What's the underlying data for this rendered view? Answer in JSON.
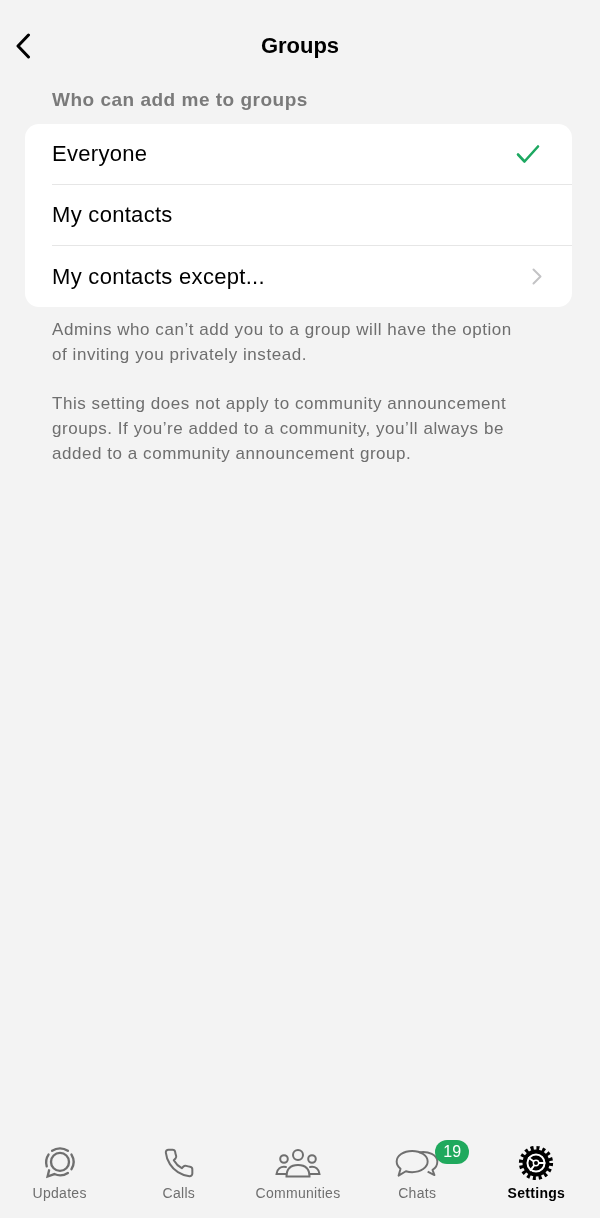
{
  "header": {
    "title": "Groups"
  },
  "section": {
    "title": "Who can add me to groups",
    "options": [
      {
        "label": "Everyone",
        "selected": true,
        "kind": "option"
      },
      {
        "label": "My contacts",
        "selected": false,
        "kind": "option"
      },
      {
        "label": "My contacts except...",
        "selected": false,
        "kind": "submenu"
      }
    ]
  },
  "notes": [
    "Admins who can’t add you to a group will have the option of inviting you privately instead.",
    "This setting does not apply to community announcement groups. If you’re added to a community, you’ll always be added to a community announcement group."
  ],
  "tab_bar": [
    {
      "label": "Updates",
      "kind": "updates",
      "selected": false
    },
    {
      "label": "Calls",
      "kind": "calls",
      "selected": false
    },
    {
      "label": "Communities",
      "kind": "communities",
      "selected": false
    },
    {
      "label": "Chats",
      "kind": "chats",
      "selected": false,
      "badge": "19"
    },
    {
      "label": "Settings",
      "kind": "settings",
      "selected": true
    }
  ]
}
